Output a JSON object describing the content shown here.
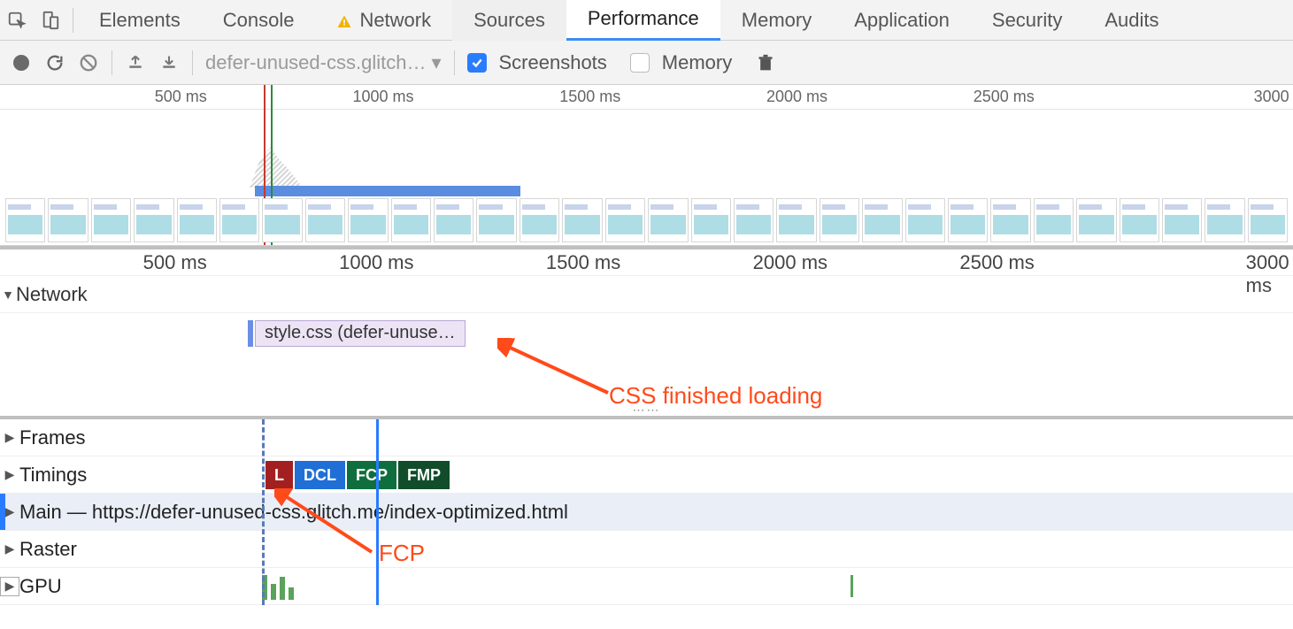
{
  "tabs": {
    "elements": "Elements",
    "console": "Console",
    "network": "Network",
    "sources": "Sources",
    "performance": "Performance",
    "memory": "Memory",
    "application": "Application",
    "security": "Security",
    "audits": "Audits"
  },
  "toolbar": {
    "filename": "defer-unused-css.glitch…",
    "screenshots_label": "Screenshots",
    "memory_label": "Memory",
    "screenshots_checked": true,
    "memory_checked": false
  },
  "overview_ruler": {
    "ticks": [
      {
        "label": "500 ms",
        "pct": 16
      },
      {
        "label": "1000 ms",
        "pct": 32
      },
      {
        "label": "1500 ms",
        "pct": 48
      },
      {
        "label": "2000 ms",
        "pct": 64
      },
      {
        "label": "2500 ms",
        "pct": 80
      },
      {
        "label": "3000",
        "pct": 99.7
      }
    ]
  },
  "detail_ruler": {
    "ticks": [
      {
        "label": "500 ms",
        "pct": 16
      },
      {
        "label": "1000 ms",
        "pct": 32
      },
      {
        "label": "1500 ms",
        "pct": 48
      },
      {
        "label": "2000 ms",
        "pct": 64
      },
      {
        "label": "2500 ms",
        "pct": 80
      },
      {
        "label": "3000 ms",
        "pct": 99.7
      }
    ]
  },
  "tracks": {
    "network": "Network",
    "frames": "Frames",
    "timings": "Timings",
    "main": "Main — https://defer-unused-css.glitch.me/index-optimized.html",
    "raster": "Raster",
    "gpu": "GPU"
  },
  "network_item": "style.css (defer-unuse…",
  "timing_badges": {
    "L": "L",
    "DCL": "DCL",
    "FCP": "FCP",
    "FMP": "FMP"
  },
  "annotations": {
    "css_loaded": "CSS finished loading",
    "fcp": "FCP"
  }
}
